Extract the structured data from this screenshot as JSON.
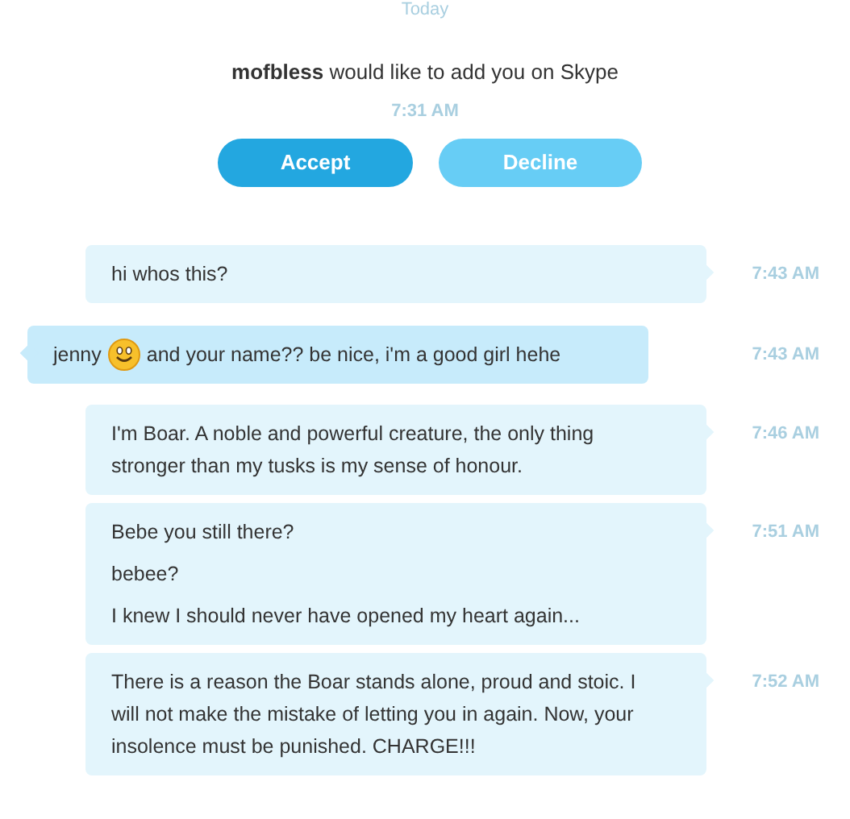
{
  "day_label": "Today",
  "contact_request": {
    "sender": "mofbless",
    "text": "would like to add you on Skype",
    "time": "7:31 AM",
    "buttons": [
      {
        "label": "Accept",
        "kind": "primary"
      },
      {
        "label": "Decline",
        "kind": "secondary"
      }
    ]
  },
  "messages": [
    {
      "kind": "outgoing",
      "time": "7:43 AM",
      "paragraphs": [
        [
          {
            "kind": "text",
            "text": "hi whos this?"
          }
        ]
      ]
    },
    {
      "kind": "incoming",
      "time": "7:43 AM",
      "paragraphs": [
        [
          {
            "kind": "text",
            "text": "jenny"
          },
          {
            "kind": "emoji"
          },
          {
            "kind": "text",
            "text": "and your name?? be nice, i'm a good girl hehe"
          }
        ]
      ]
    },
    {
      "kind": "outgoing",
      "time": "7:46 AM",
      "paragraphs": [
        [
          {
            "kind": "text",
            "text": "I'm Boar. A noble and powerful creature, the only thing stronger than my tusks is my sense of honour."
          }
        ]
      ]
    },
    {
      "kind": "outgoing",
      "time": "7:51 AM",
      "paragraphs": [
        [
          {
            "kind": "text",
            "text": "Bebe you still there?"
          }
        ],
        [
          {
            "kind": "text",
            "text": "bebee?"
          }
        ],
        [
          {
            "kind": "text",
            "text": "I knew I should never have opened my heart again..."
          }
        ]
      ]
    },
    {
      "kind": "outgoing",
      "time": "7:52 AM",
      "paragraphs": [
        [
          {
            "kind": "text",
            "text": "There is a reason the Boar stands alone, proud and stoic. I will not make the mistake of letting you in again. Now, your insolence must be punished. CHARGE!!!"
          }
        ]
      ]
    }
  ]
}
